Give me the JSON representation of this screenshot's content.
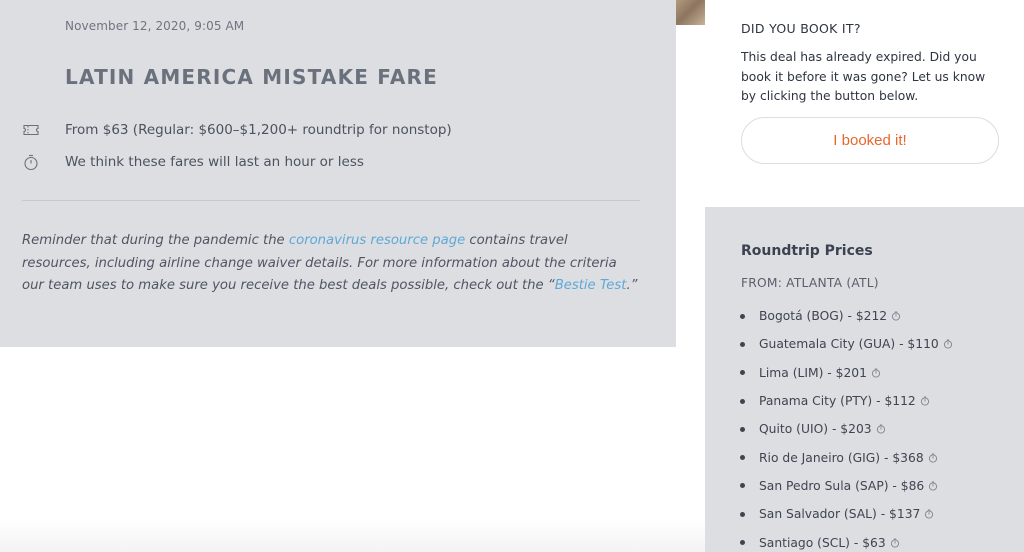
{
  "deal": {
    "date": "November 12, 2020, 9:05 AM",
    "title": "LATIN AMERICA MISTAKE FARE",
    "price_line": "From $63 (Regular: $600–$1,200+ roundtrip for nonstop)",
    "time_line": "We think these fares will last an hour or less",
    "reminder": {
      "part1": "Reminder that during the pandemic the ",
      "link1": "coronavirus resource page",
      "part2": " contains travel resources, including airline change waiver details. For more information about the criteria our team uses to make sure you receive the best deals possible, check out the “",
      "link2": "Bestie Test",
      "part3": ".”"
    },
    "icons": {
      "price": "ticket-icon",
      "time": "stopwatch-icon"
    }
  },
  "booked": {
    "heading": "DID YOU BOOK IT?",
    "text": "This deal has already expired. Did you book it before it was gone? Let us know by clicking the button below.",
    "button_label": "I booked it!"
  },
  "prices": {
    "title": "Roundtrip Prices",
    "from": "FROM: ATLANTA (ATL)",
    "items": [
      {
        "label": "Bogotá (BOG) - $212"
      },
      {
        "label": "Guatemala City (GUA) - $110"
      },
      {
        "label": "Lima (LIM) - $201"
      },
      {
        "label": "Panama City (PTY) - $112"
      },
      {
        "label": "Quito (UIO) - $203"
      },
      {
        "label": "Rio de Janeiro (GIG) - $368"
      },
      {
        "label": "San Pedro Sula (SAP) - $86"
      },
      {
        "label": "San Salvador (SAL) - $137"
      },
      {
        "label": "Santiago (SCL) - $63"
      }
    ]
  },
  "colors": {
    "panel_bg": "#dddee2",
    "accent_orange": "#e8672d",
    "link_blue": "#5fa8d8"
  }
}
